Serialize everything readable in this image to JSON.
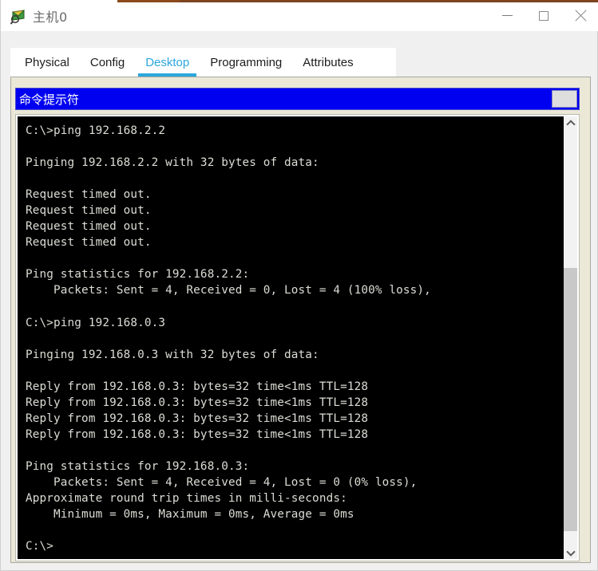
{
  "window": {
    "title": "主机0",
    "icon": "packet-tracer-device-icon",
    "controls": {
      "minimize": "—",
      "maximize": "□",
      "close": "✕"
    }
  },
  "tabs": [
    {
      "label": "Physical",
      "active": false
    },
    {
      "label": "Config",
      "active": false
    },
    {
      "label": "Desktop",
      "active": true
    },
    {
      "label": "Programming",
      "active": false
    },
    {
      "label": "Attributes",
      "active": false
    }
  ],
  "cmd_window": {
    "title": "命令提示符",
    "title_button_label": ""
  },
  "terminal": {
    "lines": [
      "C:\\>ping 192.168.2.2",
      "",
      "Pinging 192.168.2.2 with 32 bytes of data:",
      "",
      "Request timed out.",
      "Request timed out.",
      "Request timed out.",
      "Request timed out.",
      "",
      "Ping statistics for 192.168.2.2:",
      "    Packets: Sent = 4, Received = 0, Lost = 4 (100% loss),",
      "",
      "C:\\>ping 192.168.0.3",
      "",
      "Pinging 192.168.0.3 with 32 bytes of data:",
      "",
      "Reply from 192.168.0.3: bytes=32 time<1ms TTL=128",
      "Reply from 192.168.0.3: bytes=32 time<1ms TTL=128",
      "Reply from 192.168.0.3: bytes=32 time<1ms TTL=128",
      "Reply from 192.168.0.3: bytes=32 time<1ms TTL=128",
      "",
      "Ping statistics for 192.168.0.3:",
      "    Packets: Sent = 4, Received = 4, Lost = 0 (0% loss),",
      "Approximate round trip times in milli-seconds:",
      "    Minimum = 0ms, Maximum = 0ms, Average = 0ms",
      "",
      "C:\\>"
    ],
    "text": "C:\\>ping 192.168.2.2\n\nPinging 192.168.2.2 with 32 bytes of data:\n\nRequest timed out.\nRequest timed out.\nRequest timed out.\nRequest timed out.\n\nPing statistics for 192.168.2.2:\n    Packets: Sent = 4, Received = 0, Lost = 4 (100% loss),\n\nC:\\>ping 192.168.0.3\n\nPinging 192.168.0.3 with 32 bytes of data:\n\nReply from 192.168.0.3: bytes=32 time<1ms TTL=128\nReply from 192.168.0.3: bytes=32 time<1ms TTL=128\nReply from 192.168.0.3: bytes=32 time<1ms TTL=128\nReply from 192.168.0.3: bytes=32 time<1ms TTL=128\n\nPing statistics for 192.168.0.3:\n    Packets: Sent = 4, Received = 4, Lost = 0 (0% loss),\nApproximate round trip times in milli-seconds:\n    Minimum = 0ms, Maximum = 0ms, Average = 0ms\n\nC:\\>",
    "foreground_color": "#ddddd6",
    "background_color": "#000000"
  },
  "scrollbar": {
    "up_arrow": "chevron-up",
    "down_arrow": "chevron-down"
  },
  "colors": {
    "accent_blue": "#2ba6dd",
    "cmd_titlebar_blue": "#0000f0",
    "panel_beige": "#ebe8d8",
    "window_gray": "#f0f0f0"
  }
}
